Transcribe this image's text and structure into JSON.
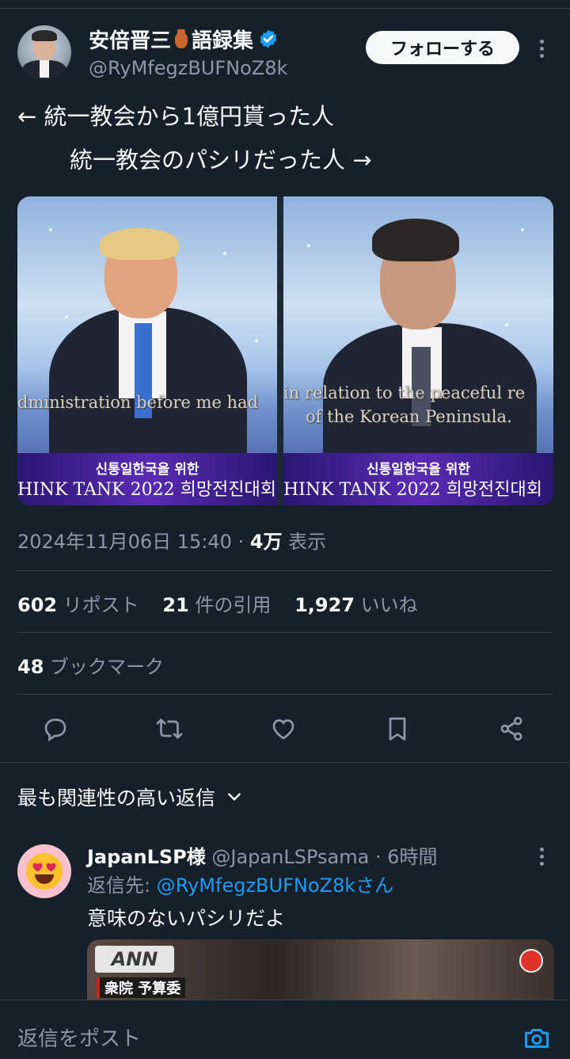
{
  "author": {
    "display_name_part1": "安倍晋三",
    "display_name_part2": "語録集",
    "handle": "@RyMfegzBUFNoZ8k",
    "follow_label": "フォローする"
  },
  "tweet": {
    "line1": "← 統一教会から1億円貰った人",
    "line2": "統一教会のパシリだった人 →"
  },
  "media": {
    "left_subtitle": "dministration before me had",
    "right_subtitle_1": "in relation to the peaceful re",
    "right_subtitle_2": "of the Korean Peninsula.",
    "banner_korean": "신통일한국을 위한",
    "left_banner_en": "HINK TANK 2022 희망전진대회",
    "right_banner_en": "HINK TANK 2022 희망전진대회"
  },
  "meta": {
    "timestamp": "2024年11月06日 15:40 · ",
    "views_count": "4万",
    "views_label": " 表示"
  },
  "stats": {
    "reposts_count": "602",
    "reposts_label": " リポスト",
    "quotes_count": "21",
    "quotes_label": " 件の引用",
    "likes_count": "1,927",
    "likes_label": " いいね",
    "bookmarks_count": "48",
    "bookmarks_label": " ブックマーク"
  },
  "sort": {
    "label": "最も関連性の高い返信"
  },
  "reply": {
    "name": "JapanLSP様",
    "handle_time": " @JapanLSPsama · 6時間",
    "reply_to_prefix": "返信先: ",
    "reply_to_handle": "@RyMfegzBUFNoZ8kさん",
    "text": "意味のないパシリだよ",
    "media_logo": "ANN",
    "media_caption": "衆院 予算委"
  },
  "composer": {
    "placeholder": "返信をポスト"
  },
  "colors": {
    "background": "#15202b",
    "text_primary": "#f7f9f9",
    "text_secondary": "#8b98a5",
    "accent_blue": "#1d9bf0",
    "divider": "#38444d"
  },
  "icons": [
    "verified-badge-icon",
    "vase-icon",
    "more-icon",
    "reply-icon",
    "repost-icon",
    "like-icon",
    "bookmark-icon",
    "share-icon",
    "chevron-down-icon",
    "camera-icon"
  ]
}
